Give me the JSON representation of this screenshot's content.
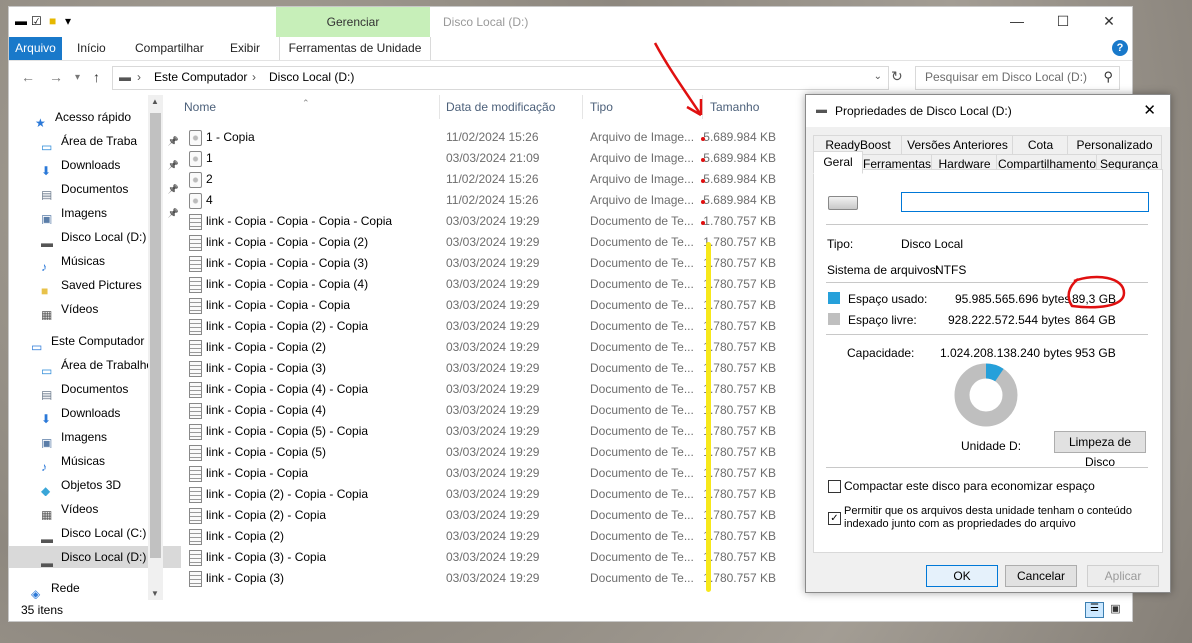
{
  "window": {
    "title": "Disco Local (D:)",
    "context_tab_group": "Gerenciar",
    "minimize": "—",
    "maximize": "☐",
    "close": "✕"
  },
  "ribbon": {
    "tabs": [
      "Arquivo",
      "Início",
      "Compartilhar",
      "Exibir",
      "Ferramentas de Unidade"
    ],
    "help": "?"
  },
  "address": {
    "path": [
      "Este Computador",
      "Disco Local (D:)"
    ],
    "search_placeholder": "Pesquisar em Disco Local (D:)"
  },
  "nav": {
    "items": [
      {
        "label": "Acesso rápido",
        "icon": "star-icon",
        "pinned": false
      },
      {
        "label": "Área de Traba",
        "icon": "desktop-icon",
        "pinned": true
      },
      {
        "label": "Downloads",
        "icon": "download-icon",
        "pinned": true
      },
      {
        "label": "Documentos",
        "icon": "document-icon",
        "pinned": true
      },
      {
        "label": "Imagens",
        "icon": "image-icon",
        "pinned": true
      },
      {
        "label": "Disco Local (D:)",
        "icon": "drive-icon",
        "pinned": false
      },
      {
        "label": "Músicas",
        "icon": "music-icon",
        "pinned": false
      },
      {
        "label": "Saved Pictures",
        "icon": "folder-icon",
        "pinned": false
      },
      {
        "label": "Vídeos",
        "icon": "video-icon",
        "pinned": false
      },
      {
        "label": "Este Computador",
        "icon": "computer-icon",
        "pinned": false
      },
      {
        "label": "Área de Trabalho",
        "icon": "desktop-icon",
        "pinned": false
      },
      {
        "label": "Documentos",
        "icon": "document-icon",
        "pinned": false
      },
      {
        "label": "Downloads",
        "icon": "download-icon",
        "pinned": false
      },
      {
        "label": "Imagens",
        "icon": "image-icon",
        "pinned": false
      },
      {
        "label": "Músicas",
        "icon": "music-icon",
        "pinned": false
      },
      {
        "label": "Objetos 3D",
        "icon": "cube-icon",
        "pinned": false
      },
      {
        "label": "Vídeos",
        "icon": "video-icon",
        "pinned": false
      },
      {
        "label": "Disco Local (C:)",
        "icon": "drive-icon",
        "pinned": false
      },
      {
        "label": "Disco Local (D:)",
        "icon": "drive-icon",
        "pinned": false
      },
      {
        "label": "Rede",
        "icon": "network-icon",
        "pinned": false
      }
    ]
  },
  "columns": [
    "Nome",
    "Data de modificação",
    "Tipo",
    "Tamanho"
  ],
  "files": [
    {
      "name": "1 - Copia",
      "date": "11/02/2024 15:26",
      "type": "Arquivo de Image...",
      "size": "5.689.984 KB"
    },
    {
      "name": "1",
      "date": "03/03/2024 21:09",
      "type": "Arquivo de Image...",
      "size": "5.689.984 KB"
    },
    {
      "name": "2",
      "date": "11/02/2024 15:26",
      "type": "Arquivo de Image...",
      "size": "5.689.984 KB"
    },
    {
      "name": "4",
      "date": "11/02/2024 15:26",
      "type": "Arquivo de Image...",
      "size": "5.689.984 KB"
    },
    {
      "name": "link - Copia - Copia - Copia - Copia",
      "date": "03/03/2024 19:29",
      "type": "Documento de Te...",
      "size": "1.780.757 KB"
    },
    {
      "name": "link - Copia - Copia - Copia (2)",
      "date": "03/03/2024 19:29",
      "type": "Documento de Te...",
      "size": "1.780.757 KB"
    },
    {
      "name": "link - Copia - Copia - Copia (3)",
      "date": "03/03/2024 19:29",
      "type": "Documento de Te...",
      "size": "1.780.757 KB"
    },
    {
      "name": "link - Copia - Copia - Copia (4)",
      "date": "03/03/2024 19:29",
      "type": "Documento de Te...",
      "size": "1.780.757 KB"
    },
    {
      "name": "link - Copia - Copia - Copia",
      "date": "03/03/2024 19:29",
      "type": "Documento de Te...",
      "size": "1.780.757 KB"
    },
    {
      "name": "link - Copia - Copia (2) - Copia",
      "date": "03/03/2024 19:29",
      "type": "Documento de Te...",
      "size": "1.780.757 KB"
    },
    {
      "name": "link - Copia - Copia (2)",
      "date": "03/03/2024 19:29",
      "type": "Documento de Te...",
      "size": "1.780.757 KB"
    },
    {
      "name": "link - Copia - Copia (3)",
      "date": "03/03/2024 19:29",
      "type": "Documento de Te...",
      "size": "1.780.757 KB"
    },
    {
      "name": "link - Copia - Copia (4) - Copia",
      "date": "03/03/2024 19:29",
      "type": "Documento de Te...",
      "size": "1.780.757 KB"
    },
    {
      "name": "link - Copia - Copia (4)",
      "date": "03/03/2024 19:29",
      "type": "Documento de Te...",
      "size": "1.780.757 KB"
    },
    {
      "name": "link - Copia - Copia (5) - Copia",
      "date": "03/03/2024 19:29",
      "type": "Documento de Te...",
      "size": "1.780.757 KB"
    },
    {
      "name": "link - Copia - Copia (5)",
      "date": "03/03/2024 19:29",
      "type": "Documento de Te...",
      "size": "1.780.757 KB"
    },
    {
      "name": "link - Copia - Copia",
      "date": "03/03/2024 19:29",
      "type": "Documento de Te...",
      "size": "1.780.757 KB"
    },
    {
      "name": "link - Copia (2) - Copia - Copia",
      "date": "03/03/2024 19:29",
      "type": "Documento de Te...",
      "size": "1.780.757 KB"
    },
    {
      "name": "link - Copia (2) - Copia",
      "date": "03/03/2024 19:29",
      "type": "Documento de Te...",
      "size": "1.780.757 KB"
    },
    {
      "name": "link - Copia (2)",
      "date": "03/03/2024 19:29",
      "type": "Documento de Te...",
      "size": "1.780.757 KB"
    },
    {
      "name": "link - Copia (3) - Copia",
      "date": "03/03/2024 19:29",
      "type": "Documento de Te...",
      "size": "1.780.757 KB"
    },
    {
      "name": "link - Copia (3)",
      "date": "03/03/2024 19:29",
      "type": "Documento de Te...",
      "size": "1.780.757 KB"
    }
  ],
  "status": {
    "items_count": "35 itens"
  },
  "dialog": {
    "title": "Propriedades de Disco Local (D:)",
    "tabs_row1": [
      "ReadyBoost",
      "Versões Anteriores",
      "Cota",
      "Personalizado"
    ],
    "tabs_row2": [
      "Geral",
      "Ferramentas",
      "Hardware",
      "Compartilhamento",
      "Segurança"
    ],
    "name_value": "",
    "type_label": "Tipo:",
    "type_value": "Disco Local",
    "fs_label": "Sistema de arquivos:",
    "fs_value": "NTFS",
    "used_label": "Espaço usado:",
    "used_bytes": "95.985.565.696 bytes",
    "used_gb": "89,3 GB",
    "free_label": "Espaço livre:",
    "free_bytes": "928.222.572.544 bytes",
    "free_gb": "864 GB",
    "capacity_label": "Capacidade:",
    "capacity_bytes": "1.024.208.138.240 bytes",
    "capacity_gb": "953 GB",
    "unit_label": "Unidade D:",
    "cleanup_button": "Limpeza de Disco",
    "compress_label": "Compactar este disco para economizar espaço",
    "compress_checked": false,
    "index_label_line1": "Permitir que os arquivos desta unidade tenham o conteúdo",
    "index_label_line2": "indexado junto com as propriedades do arquivo",
    "index_checked": true,
    "ok": "OK",
    "cancel": "Cancelar",
    "apply": "Aplicar",
    "used_fraction": 0.094,
    "used_color": "#26a0da",
    "free_color": "#bfbfbf"
  }
}
